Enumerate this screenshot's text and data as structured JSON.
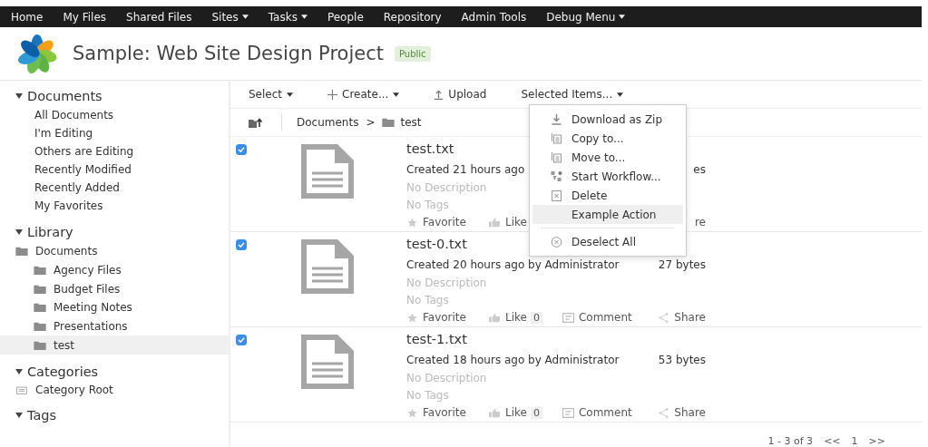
{
  "nav": [
    {
      "label": "Home",
      "dropdown": false
    },
    {
      "label": "My Files",
      "dropdown": false
    },
    {
      "label": "Shared Files",
      "dropdown": false
    },
    {
      "label": "Sites",
      "dropdown": true
    },
    {
      "label": "Tasks",
      "dropdown": true
    },
    {
      "label": "People",
      "dropdown": false
    },
    {
      "label": "Repository",
      "dropdown": false
    },
    {
      "label": "Admin Tools",
      "dropdown": false
    },
    {
      "label": "Debug Menu",
      "dropdown": true
    }
  ],
  "header": {
    "title": "Sample: Web Site Design Project",
    "badge": "Public"
  },
  "sidebar": {
    "sections": [
      {
        "title": "Documents",
        "expanded": true,
        "kind": "links",
        "items": [
          {
            "label": "All Documents"
          },
          {
            "label": "I'm Editing"
          },
          {
            "label": "Others are Editing"
          },
          {
            "label": "Recently Modified"
          },
          {
            "label": "Recently Added"
          },
          {
            "label": "My Favorites"
          }
        ]
      },
      {
        "title": "Library",
        "expanded": true,
        "kind": "tree",
        "items": [
          {
            "label": "Documents",
            "selected": false,
            "children": [
              {
                "label": "Agency Files",
                "selected": false
              },
              {
                "label": "Budget Files",
                "selected": false
              },
              {
                "label": "Meeting Notes",
                "selected": false
              },
              {
                "label": "Presentations",
                "selected": false
              },
              {
                "label": "test",
                "selected": true
              }
            ]
          }
        ]
      },
      {
        "title": "Categories",
        "expanded": true,
        "kind": "categories",
        "items": [
          {
            "label": "Category Root"
          }
        ]
      },
      {
        "title": "Tags",
        "expanded": true,
        "kind": "links"
      }
    ]
  },
  "toolbar": [
    {
      "label": "Select",
      "dropdown": true
    },
    {
      "label": "Create...",
      "dropdown": true
    },
    {
      "label": "Upload",
      "dropdown": false
    },
    {
      "label": "Selected Items...",
      "dropdown": true
    }
  ],
  "breadcrumb": {
    "root": "Documents",
    "separator": ">",
    "current": "test"
  },
  "documents": [
    {
      "name": "test.txt",
      "checked": true,
      "created": "Created 21 hours ago",
      "size": "es",
      "description": "No Description",
      "tags": "No Tags",
      "favorite": "Favorite",
      "like": "Like",
      "share": "re"
    },
    {
      "name": "test-0.txt",
      "checked": true,
      "created": "Created 20 hours ago by Administrator",
      "size": "27 bytes",
      "description": "No Description",
      "tags": "No Tags",
      "favorite": "Favorite",
      "like": "Like",
      "like_count": "0",
      "comment": "Comment",
      "share": "Share"
    },
    {
      "name": "test-1.txt",
      "checked": true,
      "created": "Created 18 hours ago by Administrator",
      "size": "53 bytes",
      "description": "No Description",
      "tags": "No Tags",
      "favorite": "Favorite",
      "like": "Like",
      "like_count": "0",
      "comment": "Comment",
      "share": "Share"
    }
  ],
  "menu": {
    "items": [
      {
        "label": "Download as Zip",
        "selected": false
      },
      {
        "label": "Copy to...",
        "selected": false
      },
      {
        "label": "Move to...",
        "selected": false
      },
      {
        "label": "Start Workflow...",
        "selected": false
      },
      {
        "label": "Delete",
        "selected": false
      },
      {
        "label": "Example Action",
        "selected": true
      },
      {
        "label": "Deselect All",
        "selected": false,
        "separated": true
      }
    ]
  },
  "pagination": {
    "range": "1 - 3 of 3",
    "prev": "<<",
    "page": "1",
    "next": ">>"
  }
}
